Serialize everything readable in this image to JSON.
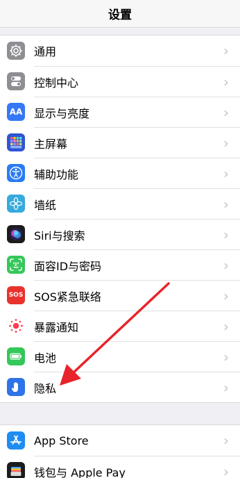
{
  "nav": {
    "title": "设置"
  },
  "group1": [
    {
      "label": "通用",
      "icon": "gear-icon",
      "color": "#8e8e93"
    },
    {
      "label": "控制中心",
      "icon": "toggles-icon",
      "color": "#8e8e93"
    },
    {
      "label": "显示与亮度",
      "icon": "display-aa-icon",
      "color": "#3478f6",
      "text": "AA"
    },
    {
      "label": "主屏幕",
      "icon": "home-screen-grid-icon",
      "color": "#2f55d4"
    },
    {
      "label": "辅助功能",
      "icon": "accessibility-icon",
      "color": "#2a7cf4"
    },
    {
      "label": "墙纸",
      "icon": "wallpaper-flower-icon",
      "color": "#36aadc"
    },
    {
      "label": "Siri与搜索",
      "icon": "siri-icon",
      "color": "#1c1c1e"
    },
    {
      "label": "面容ID与密码",
      "icon": "face-id-icon",
      "color": "#34c759"
    },
    {
      "label": "SOS紧急联络",
      "icon": "sos-icon",
      "color": "#e9322d",
      "text": "SOS"
    },
    {
      "label": "暴露通知",
      "icon": "exposure-notification-icon",
      "color": "#ffffff"
    },
    {
      "label": "电池",
      "icon": "battery-icon",
      "color": "#34c759"
    },
    {
      "label": "隐私",
      "icon": "privacy-hand-icon",
      "color": "#2f73e8"
    }
  ],
  "group2": [
    {
      "label": "App Store",
      "icon": "app-store-icon",
      "color": "#1e8cf0"
    },
    {
      "label": "钱包与 Apple Pay",
      "icon": "wallet-icon",
      "color": "#1c1c1e"
    }
  ],
  "chevron": "›",
  "annotation_color": "#e8232b"
}
